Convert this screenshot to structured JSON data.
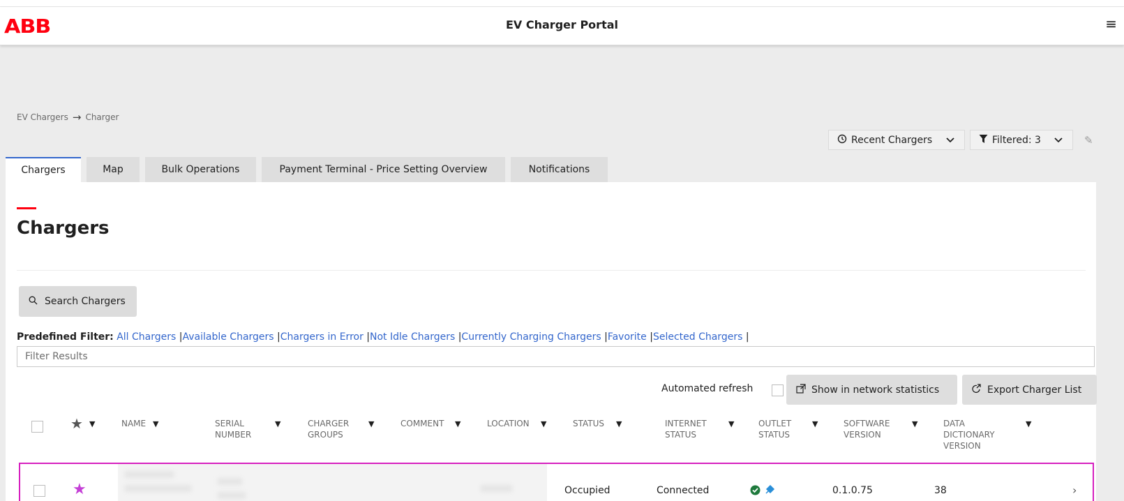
{
  "header": {
    "logo": "ABB",
    "title": "EV Charger Portal",
    "menu_icon": "hamburger-menu-icon"
  },
  "breadcrumb": [
    "EV Chargers",
    "Charger"
  ],
  "top_actions": {
    "recent": "Recent Chargers",
    "filtered": "Filtered: 3"
  },
  "tabs": [
    {
      "label": "Chargers",
      "active": true
    },
    {
      "label": "Map"
    },
    {
      "label": "Bulk Operations"
    },
    {
      "label": "Payment Terminal - Price Setting Overview"
    },
    {
      "label": "Notifications"
    }
  ],
  "page": {
    "title": "Chargers",
    "search_button": "Search Chargers",
    "predefined_label": "Predefined Filter:",
    "predefined": [
      "All Chargers",
      "Available Chargers",
      "Chargers in Error",
      "Not Idle Chargers",
      "Currently Charging Chargers",
      "Favorite",
      "Selected Chargers"
    ],
    "filter_placeholder": "Filter Results",
    "auto_refresh": "Automated refresh",
    "net_stats": "Show in network statistics",
    "export": "Export Charger List"
  },
  "table": {
    "columns": {
      "name": "NAME",
      "serial": "SERIAL NUMBER",
      "groups": "CHARGER GROUPS",
      "comment": "COMMENT",
      "location": "LOCATION",
      "status": "STATUS",
      "internet": "INTERNET STATUS",
      "outlet": "OUTLET STATUS",
      "software": "SOFTWARE VERSION",
      "dictionary": "DATA DICTIONARY VERSION"
    },
    "rows": [
      {
        "status": "Occupied",
        "internet": "Connected",
        "software": "0.1.0.75",
        "dictionary": "38"
      }
    ]
  },
  "colors": {
    "brand_red": "#ff000f",
    "link_blue": "#3366cc",
    "selected_row": "#d61fbf",
    "favorite_star": "#c43fd6",
    "status_green": "#1e7a3c",
    "plug_blue": "#2a8fd8"
  }
}
